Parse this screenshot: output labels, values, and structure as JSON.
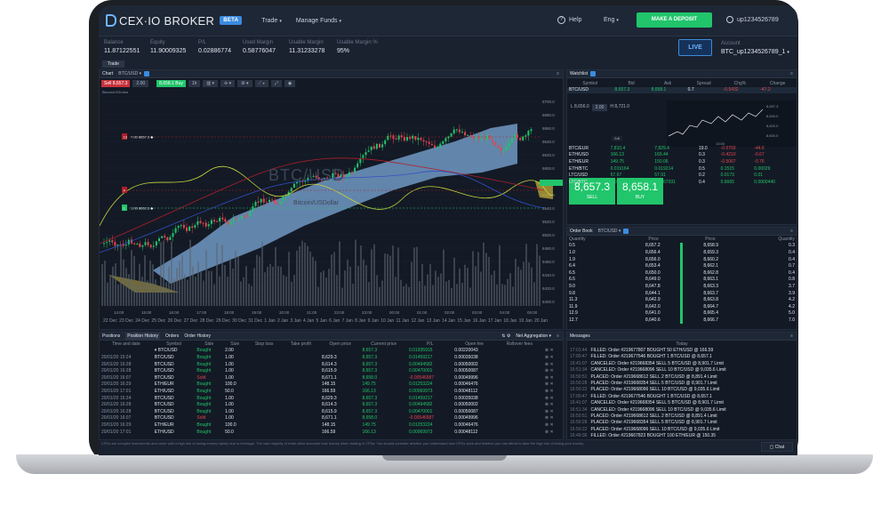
{
  "brand": {
    "name": "CEX·IO BROKER",
    "beta": "BETA"
  },
  "nav": {
    "trade": "Trade",
    "funds": "Manage Funds",
    "help": "Help",
    "lang": "Eng",
    "deposit": "MAKE A DEPOSIT",
    "user": "up1234526789"
  },
  "stats": [
    {
      "label": "Balance",
      "value": "11.87122551"
    },
    {
      "label": "Equity",
      "value": "11.90009325"
    },
    {
      "label": "P/L",
      "value": "0.02886774"
    },
    {
      "label": "Used Margin",
      "value": "0.58776047"
    },
    {
      "label": "Usable Margin",
      "value": "11.31233278"
    },
    {
      "label": "Usable Margin %",
      "value": "95%"
    }
  ],
  "account": {
    "live": "LIVE",
    "label": "Account",
    "value": "BTC_up1234526789_1"
  },
  "tabs": {
    "trade": "Trade"
  },
  "chart": {
    "title": "Chart",
    "symbol": "BTC/USD",
    "sell": "Sell 8,657.3",
    "qty": "2.00",
    "buy": "8,658.1 Buy",
    "interval": "1h",
    "watermark": "BTC/USD",
    "watermark_sub": "Bitcoin/USDollar",
    "legend": "Bitcoin/USDollar",
    "price_ticks": [
      "8700.0",
      "8680.0",
      "8660.0",
      "8640.0",
      "8620.0",
      "8600.0",
      "8580.0",
      "8560.0",
      "8540.0",
      "8520.0",
      "8500.0",
      "8480.0",
      "8460.0",
      "8440.0",
      "8420.0",
      "8400.0"
    ],
    "time_ticks": [
      "14:00",
      "15:00",
      "16:00",
      "17:00",
      "18:00",
      "19:00",
      "20:00",
      "21:00",
      "22:00",
      "23:00",
      "00:00",
      "01:00",
      "02:00",
      "03:00",
      "04:00",
      "05:00"
    ],
    "date_ticks": [
      "22 Dec",
      "23 Dec",
      "24 Dec",
      "25 Dec",
      "26 Dec",
      "27 Dec",
      "28 Dec",
      "29 Dec",
      "30 Dec",
      "31 Dec",
      "1 Jan",
      "2 Jan",
      "3 Jan",
      "4 Jan",
      "5 Jan",
      "6 Jan",
      "7 Jan",
      "8 Jan",
      "9 Jan",
      "10 Jan",
      "11 Jan",
      "12 Jan",
      "13 Jan",
      "14 Jan",
      "15 Jan",
      "16 Jan",
      "17 Jan",
      "18 Jan",
      "19 Jan",
      "20 Jan"
    ],
    "markers": [
      "7.00 8657.3 ◆",
      "1.00 8662.3 ◆"
    ],
    "marker_labels": [
      "13",
      "4",
      "1"
    ]
  },
  "watchlist": {
    "title": "Watchlist",
    "headers": [
      "Symbol",
      "Bid",
      "Ask",
      "Spread",
      "Chg%",
      "Change"
    ],
    "rows": [
      {
        "symbol": "BTC/USD",
        "bid": "8,657.3",
        "ask": "8,658.1",
        "spread": "0.7",
        "chgp": "-0.5432",
        "chg": "-47.2"
      },
      {
        "symbol": "BTC/EUR",
        "bid": "7,810.4",
        "ask": "7,829.4",
        "spread": "19.0",
        "chgp": "-0.5703",
        "chg": "-44.6"
      },
      {
        "symbol": "ETH/USD",
        "bid": "166.13",
        "ask": "166.44",
        "spread": "0.3",
        "chgp": "-0.4210",
        "chg": "-0.67"
      },
      {
        "symbol": "ETH/EUR",
        "bid": "149.75",
        "ask": "150.06",
        "spread": "0.3",
        "chgp": "-0.5067",
        "chg": "-0.76"
      },
      {
        "symbol": "ETH/BTC",
        "bid": "0.019164",
        "ask": "0.019214",
        "spread": "0.5",
        "chgp": "0.1515",
        "chg": "0.00029"
      },
      {
        "symbol": "LTC/USD",
        "bid": "57.67",
        "ask": "57.91",
        "spread": "0.2",
        "chgp": "0.0173",
        "chg": "0.01"
      },
      {
        "symbol": "LTC/BTC",
        "bid": "0.0066688",
        "ask": "0.0067031",
        "spread": "0.4",
        "chgp": "0.6665",
        "chg": "0.0000440"
      }
    ],
    "order_qty": "2.00",
    "sell": {
      "price": "8,657.3",
      "label": "SELL"
    },
    "buy": {
      "price": "8,658.1",
      "label": "BUY"
    },
    "spread": "0.8",
    "left_price": "L 8,656.0",
    "right_price": "H 8,721.0",
    "mini_ticks": [
      "8,657.3",
      "8,640.0",
      "8,620.0",
      "8,600.0"
    ],
    "mini_time": "13:00"
  },
  "orderbook": {
    "title": "Order Book",
    "symbol": "BTC/USD",
    "headers": [
      "Quantity",
      "Price",
      "Price",
      "Quantity"
    ],
    "rows": [
      [
        "0.5",
        "8,657.2",
        "8,658.9",
        "0.3"
      ],
      [
        "1.0",
        "8,656.4",
        "8,659.3",
        "0.4"
      ],
      [
        "1.9",
        "8,656.0",
        "8,660.2",
        "0.4"
      ],
      [
        "6.4",
        "8,653.4",
        "8,662.1",
        "0.7"
      ],
      [
        "6.5",
        "8,650.0",
        "8,662.8",
        "0.4"
      ],
      [
        "6.5",
        "8,649.0",
        "8,663.1",
        "0.8"
      ],
      [
        "9.0",
        "8,647.8",
        "8,663.3",
        "3.7"
      ],
      [
        "9.8",
        "8,644.1",
        "8,663.7",
        "3.9"
      ],
      [
        "11.3",
        "8,642.9",
        "8,663.8",
        "4.2"
      ],
      [
        "11.9",
        "8,642.0",
        "8,664.7",
        "4.2"
      ],
      [
        "12.9",
        "8,641.0",
        "8,665.4",
        "5.0"
      ],
      [
        "12.7",
        "8,640.6",
        "8,666.7",
        "7.0"
      ]
    ]
  },
  "positions": {
    "tabs": [
      "Positions",
      "Position History",
      "Orders",
      "Order History"
    ],
    "filter": "Net Aggregation",
    "headers": [
      "Time and date",
      "Symbol",
      "Side",
      "Size",
      "Stop loss",
      "Take profit",
      "Open price",
      "Current price",
      "P/L",
      "Open fee",
      "Rollover fees"
    ],
    "rows": [
      {
        "date": "",
        "symbol": "BTC/USD",
        "side": "Bought",
        "size": "2.00",
        "open": "",
        "cur": "8,657.3",
        "pl": "0.01935915",
        "fee": "0.00220043",
        "roll": ""
      },
      {
        "date": "20/01/20 15:24",
        "symbol": "BTC/USD",
        "side": "Bought",
        "size": "1.00",
        "open": "8,629.3",
        "cur": "8,657.3",
        "pl": "0.01459217",
        "fee": "0.00035038",
        "roll": ""
      },
      {
        "date": "20/01/20 16:28",
        "symbol": "BTC/USD",
        "side": "Bought",
        "size": "1.00",
        "open": "8,614.3",
        "cur": "8,657.3",
        "pl": "0.00494582",
        "fee": "0.00050002",
        "roll": ""
      },
      {
        "date": "20/01/20 16:28",
        "symbol": "BTC/USD",
        "side": "Bought",
        "size": "1.00",
        "open": "8,615.9",
        "cur": "8,657.3",
        "pl": "0.00470001",
        "fee": "0.00050087",
        "roll": ""
      },
      {
        "date": "20/01/20 16:07",
        "symbol": "BTC/USD",
        "side": "Sold",
        "size": "1.00",
        "open": "8,671.1",
        "cur": "8,658.0",
        "pl": "-0.00546587",
        "fee": "0.00049996",
        "roll": ""
      },
      {
        "date": "20/01/20 16:29",
        "symbol": "ETH/EUR",
        "side": "Bought",
        "size": "100.0",
        "open": "148.15",
        "cur": "149.75",
        "pl": "0.01253224",
        "fee": "0.00046476",
        "roll": ""
      },
      {
        "date": "20/01/20 17:01",
        "symbol": "ETH/USD",
        "side": "Bought",
        "size": "50.0",
        "open": "166.59",
        "cur": "166.13",
        "pl": "0.00069973",
        "fee": "0.00048112",
        "roll": ""
      },
      {
        "date": "20/01/20 15:24",
        "symbol": "BTC/USD",
        "side": "Bought",
        "size": "1.00",
        "open": "8,629.3",
        "cur": "8,657.3",
        "pl": "0.01459217",
        "fee": "0.00035038",
        "roll": ""
      },
      {
        "date": "20/01/20 16:28",
        "symbol": "BTC/USD",
        "side": "Bought",
        "size": "1.00",
        "open": "8,614.3",
        "cur": "8,657.3",
        "pl": "0.00494582",
        "fee": "0.00050002",
        "roll": ""
      },
      {
        "date": "20/01/20 16:28",
        "symbol": "BTC/USD",
        "side": "Bought",
        "size": "1.00",
        "open": "8,615.9",
        "cur": "8,657.3",
        "pl": "0.00470001",
        "fee": "0.00050087",
        "roll": ""
      },
      {
        "date": "20/01/20 16:07",
        "symbol": "BTC/USD",
        "side": "Sold",
        "size": "1.00",
        "open": "8,671.1",
        "cur": "8,658.0",
        "pl": "-0.00546587",
        "fee": "0.00049996",
        "roll": ""
      },
      {
        "date": "20/01/20 16:29",
        "symbol": "ETH/EUR",
        "side": "Bought",
        "size": "100.0",
        "open": "148.15",
        "cur": "149.75",
        "pl": "0.01253224",
        "fee": "0.00046476",
        "roll": ""
      },
      {
        "date": "20/01/20 17:01",
        "symbol": "ETH/USD",
        "side": "Bought",
        "size": "50.0",
        "open": "166.59",
        "cur": "166.13",
        "pl": "0.00069973",
        "fee": "0.00048112",
        "roll": ""
      }
    ],
    "disclaimer": "CFDs are complex instruments and come with a high risk of losing money rapidly due to leverage. The vast majority of retail client accounts lose money when trading in CFDs. You should consider whether you understand how CFDs work and whether you can afford to take the high risk of losing your money."
  },
  "messages": {
    "title": "Messages",
    "today": "Today",
    "rows": [
      {
        "t": "17:01:44",
        "text": "FILLED:  Order #219677807 BOUGHT 50 ETH/USD @ 166.59"
      },
      {
        "t": "17:00:47",
        "text": "FILLED:  Order #219677546 BOUGHT 1 BTC/USD @ 8,657.1"
      },
      {
        "t": "16:41:07",
        "text": "CANCELED: Order #219668354 SELL 5 BTC/USD @ 8,901.7 Limit"
      },
      {
        "t": "16:51:34",
        "text": "CANCELED: Order #219668096 SELL 10 BTC/USD @ 9,035.6 Limit"
      },
      {
        "t": "16:50:51",
        "text": "PLACED:  Order #219668612 SELL 2 BTC/USD @ 8,891.4 Limit"
      },
      {
        "t": "16:50:28",
        "text": "PLACED:  Order #219668354 SELL 5 BTC/USD @ 8,901.7 Limit"
      },
      {
        "t": "16:50:22",
        "text": "PLACED:  Order #219668096 SELL 10 BTC/USD @ 9,035.6 Limit"
      },
      {
        "t": "17:00:47",
        "text": "FILLED:  Order #219677546 BOUGHT 1 BTC/USD @ 8,657.1"
      },
      {
        "t": "16:41:07",
        "text": "CANCELED: Order #219668354 SELL 5 BTC/USD @ 8,901.7 Limit"
      },
      {
        "t": "16:51:34",
        "text": "CANCELED: Order #219668096 SELL 10 BTC/USD @ 9,035.6 Limit"
      },
      {
        "t": "16:50:51",
        "text": "PLACED:  Order #219668612 SELL 2 BTC/USD @ 8,891.4 Limit"
      },
      {
        "t": "16:50:28",
        "text": "PLACED:  Order #219668354 SELL 5 BTC/USD @ 8,901.7 Limit"
      },
      {
        "t": "16:50:22",
        "text": "PLACED:  Order #219668096 SELL 10 BTC/USD @ 9,035.6 Limit"
      },
      {
        "t": "16:49:36",
        "text": "FILLED:  Order #219667823 BOUGHT 100 ETH/EUR @ 150.35"
      }
    ],
    "chat": "Chat"
  },
  "colors": {
    "buy": "#21c56b",
    "sell": "#e5444f",
    "accent": "#3a8be0",
    "bg": "#131a25"
  }
}
